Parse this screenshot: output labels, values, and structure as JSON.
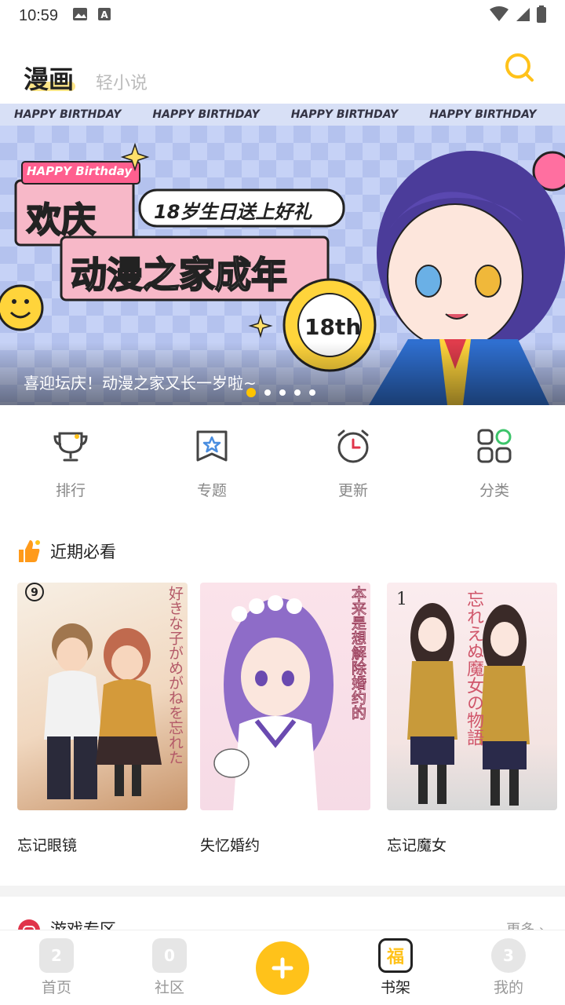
{
  "status_bar": {
    "time": "10:59"
  },
  "header": {
    "tab_active": "漫画",
    "tab_inactive": "轻小说"
  },
  "banner": {
    "strip_text": "HAPPY BIRTHDAY",
    "line1": "欢庆",
    "line2": "动漫之家成年",
    "tag": "18岁生日送上好礼",
    "badge": "HAPPY Birthday",
    "stamp": "18th",
    "caption": "喜迎坛庆！动漫之家又长一岁啦~",
    "dot_count": 5,
    "active_dot": 1
  },
  "quick_nav": [
    {
      "label": "排行",
      "icon": "trophy-icon"
    },
    {
      "label": "专题",
      "icon": "star-bookmark-icon"
    },
    {
      "label": "更新",
      "icon": "alarm-clock-icon"
    },
    {
      "label": "分类",
      "icon": "grid-icon"
    }
  ],
  "recent": {
    "title": "近期必看",
    "items": [
      {
        "name": "忘记眼镜",
        "cover_text": "好きな子がめがねを忘れた"
      },
      {
        "name": "失忆婚约",
        "cover_text": "本来是想解除婚约的"
      },
      {
        "name": "忘记魔女",
        "cover_text": "忘れえぬ魔女の物語"
      }
    ]
  },
  "section2": {
    "title": "游戏专区",
    "more": "更多 ›"
  },
  "bottom_nav": [
    {
      "label": "首页",
      "icon": "home-icon"
    },
    {
      "label": "社区",
      "icon": "community-icon"
    },
    {
      "label": "",
      "icon": "add-icon"
    },
    {
      "label": "书架",
      "icon": "bookshelf-icon"
    },
    {
      "label": "我的",
      "icon": "profile-icon"
    }
  ],
  "colors": {
    "accent": "#ffc21a",
    "banner_bg": "#c6d2f6"
  }
}
